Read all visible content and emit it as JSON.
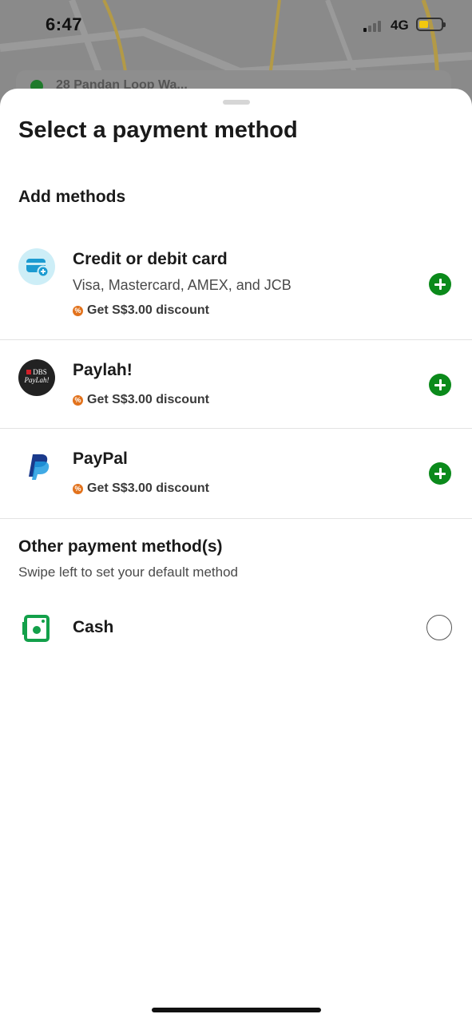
{
  "status_bar": {
    "time": "6:47",
    "network": "4G"
  },
  "map": {
    "address_peek": "28 Pandan Loop Wa..."
  },
  "sheet": {
    "title": "Select a payment method",
    "add_methods_heading": "Add methods",
    "methods": [
      {
        "name": "Credit or debit card",
        "subtitle": "Visa, Mastercard, AMEX, and JCB",
        "promo": "Get S$3.00 discount",
        "icon": "card-icon"
      },
      {
        "name": "Paylah!",
        "promo": "Get S$3.00 discount",
        "icon": "dbs-paylah-logo",
        "logo_lines": [
          "DBS",
          "PayLah!"
        ]
      },
      {
        "name": "PayPal",
        "promo": "Get S$3.00 discount",
        "icon": "paypal-logo"
      }
    ],
    "other_heading": "Other payment method(s)",
    "other_hint": "Swipe left to set your default method",
    "other_methods": [
      {
        "name": "Cash",
        "icon": "cash-icon",
        "selected": false
      }
    ]
  },
  "colors": {
    "accent_green": "#0b8a1b",
    "promo_orange": "#e2721c",
    "card_icon_bg": "#cdeef7"
  }
}
